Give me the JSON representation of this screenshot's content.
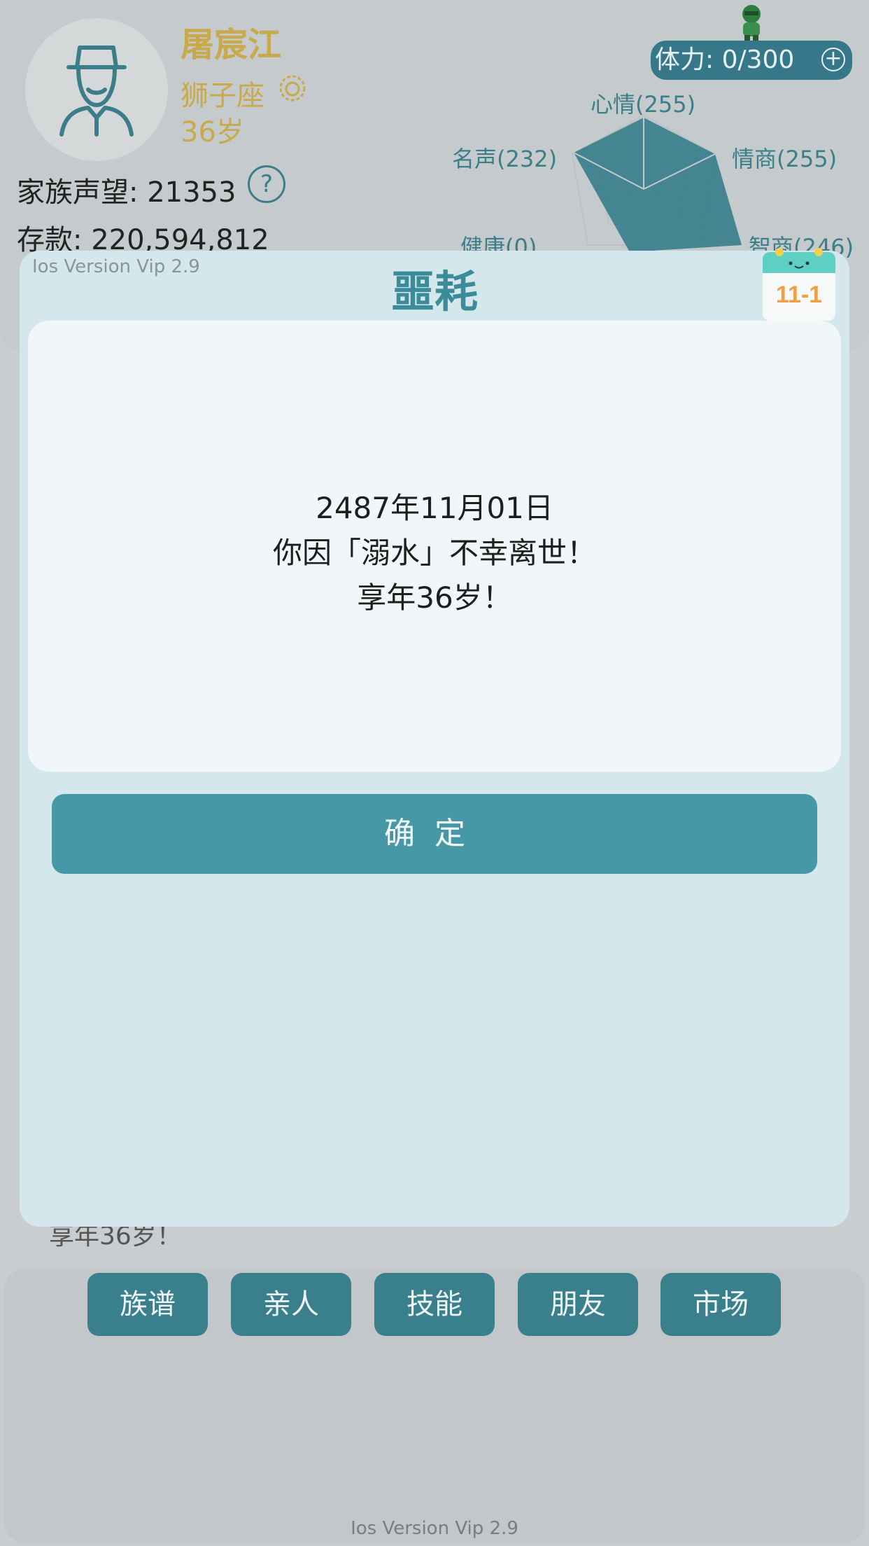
{
  "profile": {
    "name": "屠宸江",
    "zodiac": "狮子座",
    "age": "36岁",
    "fame_label": "家族声望: 21353",
    "help": "?",
    "savings_label": "存款:  220,594,812"
  },
  "stamina": {
    "label": "体力: 0/300",
    "plus": "+"
  },
  "radar": {
    "labels": {
      "mood": "心情(255)",
      "fame": "名声(232)",
      "eq": "情商(255)",
      "health": "健康(0)",
      "iq": "智商(246)"
    }
  },
  "dialog": {
    "version": "Ios Version Vip 2.9",
    "title": "噩耗",
    "calendar_date": "11-1",
    "lines": [
      "2487年11月01日",
      "你因「溺水」不幸离世！",
      "享年36岁！"
    ],
    "confirm_label": "确定"
  },
  "behind_text": "享年36岁！",
  "tabs": [
    "族谱",
    "亲人",
    "技能",
    "朋友",
    "市场"
  ],
  "footer_version": "Ios Version Vip 2.9",
  "colors": {
    "accent": "#3a7f8c",
    "gold": "#c8a94b",
    "dialog_bg": "#d4e7ed"
  }
}
